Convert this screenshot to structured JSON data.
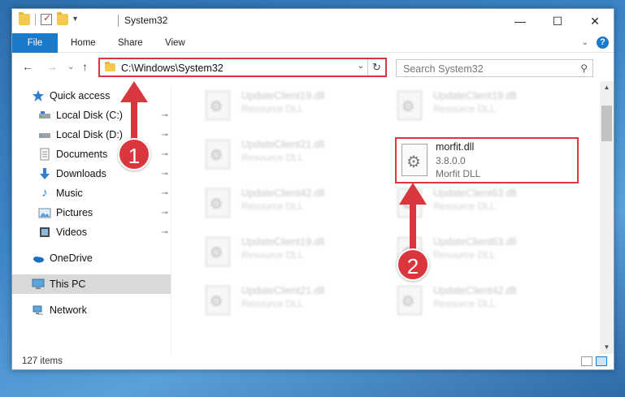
{
  "window": {
    "title": "System32",
    "min_glyph": "—",
    "max_glyph": "☐",
    "close_glyph": "✕"
  },
  "ribbon": {
    "tabs": [
      "File",
      "Home",
      "Share",
      "View"
    ],
    "expand_glyph": "⌄",
    "help_glyph": "?"
  },
  "nav": {
    "back_glyph": "←",
    "forward_glyph": "→",
    "recent_glyph": "⌄",
    "up_glyph": "↑",
    "address": "C:\\Windows\\System32",
    "address_drop_glyph": "⌄",
    "refresh_glyph": "↻",
    "search_placeholder": "Search System32",
    "search_glyph": "⚲"
  },
  "sidebar": {
    "items": [
      {
        "label": "Quick access",
        "icon": "star-icon",
        "pinned": false
      },
      {
        "label": "Local Disk (C:)",
        "icon": "drive-icon",
        "pinned": true
      },
      {
        "label": "Local Disk (D:)",
        "icon": "drive-icon",
        "pinned": true
      },
      {
        "label": "Documents",
        "icon": "documents-icon",
        "pinned": true
      },
      {
        "label": "Downloads",
        "icon": "download-icon",
        "pinned": true
      },
      {
        "label": "Music",
        "icon": "music-icon",
        "pinned": true
      },
      {
        "label": "Pictures",
        "icon": "pictures-icon",
        "pinned": true
      },
      {
        "label": "Videos",
        "icon": "videos-icon",
        "pinned": true
      },
      {
        "label": "OneDrive",
        "icon": "cloud-icon",
        "pinned": false
      },
      {
        "label": "This PC",
        "icon": "computer-icon",
        "pinned": false,
        "selected": true
      },
      {
        "label": "Network",
        "icon": "network-icon",
        "pinned": false
      }
    ],
    "pin_glyph": "📌"
  },
  "files": {
    "items": [
      {
        "name": "UpdateClient19.dll",
        "desc": "Resource DLL"
      },
      {
        "name": "UpdateClient19.dll",
        "desc": "Resource DLL"
      },
      {
        "name": "UpdateClient21.dll",
        "desc": "Resource DLL"
      },
      {
        "name": "UpdateClient42.dll",
        "desc": "Resource DLL"
      },
      {
        "name": "UpdateClient63.dll",
        "desc": "Resource DLL"
      },
      {
        "name": "UpdateClient19.dll",
        "desc": "Resource DLL"
      },
      {
        "name": "UpdateClient63.dll",
        "desc": "Resource DLL"
      },
      {
        "name": "UpdateClient21.dll",
        "desc": "Resource DLL"
      },
      {
        "name": "UpdateClient42.dll",
        "desc": "Resource DLL"
      }
    ],
    "highlighted": {
      "name": "morfit.dll",
      "version": "3.8.0.0",
      "desc": "Morfit DLL"
    }
  },
  "status": {
    "count": "127 items"
  },
  "annotations": {
    "step1": "1",
    "step2": "2"
  },
  "colors": {
    "accent": "#1979ca",
    "annotation_red": "#d9363e",
    "desktop_blue": "#3d86c6"
  }
}
